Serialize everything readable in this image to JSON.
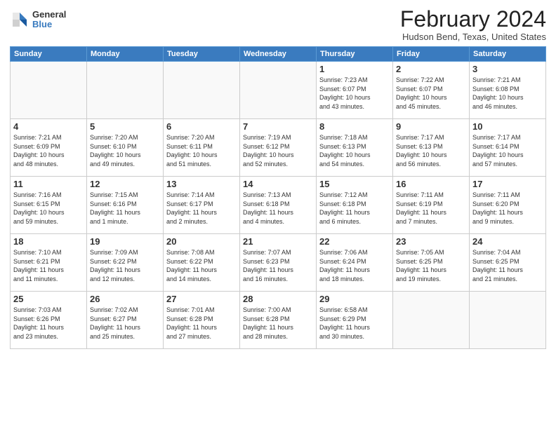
{
  "header": {
    "logo": {
      "general": "General",
      "blue": "Blue"
    },
    "title": "February 2024",
    "location": "Hudson Bend, Texas, United States"
  },
  "weekdays": [
    "Sunday",
    "Monday",
    "Tuesday",
    "Wednesday",
    "Thursday",
    "Friday",
    "Saturday"
  ],
  "weeks": [
    [
      {
        "day": "",
        "info": ""
      },
      {
        "day": "",
        "info": ""
      },
      {
        "day": "",
        "info": ""
      },
      {
        "day": "",
        "info": ""
      },
      {
        "day": "1",
        "info": "Sunrise: 7:23 AM\nSunset: 6:07 PM\nDaylight: 10 hours\nand 43 minutes."
      },
      {
        "day": "2",
        "info": "Sunrise: 7:22 AM\nSunset: 6:07 PM\nDaylight: 10 hours\nand 45 minutes."
      },
      {
        "day": "3",
        "info": "Sunrise: 7:21 AM\nSunset: 6:08 PM\nDaylight: 10 hours\nand 46 minutes."
      }
    ],
    [
      {
        "day": "4",
        "info": "Sunrise: 7:21 AM\nSunset: 6:09 PM\nDaylight: 10 hours\nand 48 minutes."
      },
      {
        "day": "5",
        "info": "Sunrise: 7:20 AM\nSunset: 6:10 PM\nDaylight: 10 hours\nand 49 minutes."
      },
      {
        "day": "6",
        "info": "Sunrise: 7:20 AM\nSunset: 6:11 PM\nDaylight: 10 hours\nand 51 minutes."
      },
      {
        "day": "7",
        "info": "Sunrise: 7:19 AM\nSunset: 6:12 PM\nDaylight: 10 hours\nand 52 minutes."
      },
      {
        "day": "8",
        "info": "Sunrise: 7:18 AM\nSunset: 6:13 PM\nDaylight: 10 hours\nand 54 minutes."
      },
      {
        "day": "9",
        "info": "Sunrise: 7:17 AM\nSunset: 6:13 PM\nDaylight: 10 hours\nand 56 minutes."
      },
      {
        "day": "10",
        "info": "Sunrise: 7:17 AM\nSunset: 6:14 PM\nDaylight: 10 hours\nand 57 minutes."
      }
    ],
    [
      {
        "day": "11",
        "info": "Sunrise: 7:16 AM\nSunset: 6:15 PM\nDaylight: 10 hours\nand 59 minutes."
      },
      {
        "day": "12",
        "info": "Sunrise: 7:15 AM\nSunset: 6:16 PM\nDaylight: 11 hours\nand 1 minute."
      },
      {
        "day": "13",
        "info": "Sunrise: 7:14 AM\nSunset: 6:17 PM\nDaylight: 11 hours\nand 2 minutes."
      },
      {
        "day": "14",
        "info": "Sunrise: 7:13 AM\nSunset: 6:18 PM\nDaylight: 11 hours\nand 4 minutes."
      },
      {
        "day": "15",
        "info": "Sunrise: 7:12 AM\nSunset: 6:18 PM\nDaylight: 11 hours\nand 6 minutes."
      },
      {
        "day": "16",
        "info": "Sunrise: 7:11 AM\nSunset: 6:19 PM\nDaylight: 11 hours\nand 7 minutes."
      },
      {
        "day": "17",
        "info": "Sunrise: 7:11 AM\nSunset: 6:20 PM\nDaylight: 11 hours\nand 9 minutes."
      }
    ],
    [
      {
        "day": "18",
        "info": "Sunrise: 7:10 AM\nSunset: 6:21 PM\nDaylight: 11 hours\nand 11 minutes."
      },
      {
        "day": "19",
        "info": "Sunrise: 7:09 AM\nSunset: 6:22 PM\nDaylight: 11 hours\nand 12 minutes."
      },
      {
        "day": "20",
        "info": "Sunrise: 7:08 AM\nSunset: 6:22 PM\nDaylight: 11 hours\nand 14 minutes."
      },
      {
        "day": "21",
        "info": "Sunrise: 7:07 AM\nSunset: 6:23 PM\nDaylight: 11 hours\nand 16 minutes."
      },
      {
        "day": "22",
        "info": "Sunrise: 7:06 AM\nSunset: 6:24 PM\nDaylight: 11 hours\nand 18 minutes."
      },
      {
        "day": "23",
        "info": "Sunrise: 7:05 AM\nSunset: 6:25 PM\nDaylight: 11 hours\nand 19 minutes."
      },
      {
        "day": "24",
        "info": "Sunrise: 7:04 AM\nSunset: 6:25 PM\nDaylight: 11 hours\nand 21 minutes."
      }
    ],
    [
      {
        "day": "25",
        "info": "Sunrise: 7:03 AM\nSunset: 6:26 PM\nDaylight: 11 hours\nand 23 minutes."
      },
      {
        "day": "26",
        "info": "Sunrise: 7:02 AM\nSunset: 6:27 PM\nDaylight: 11 hours\nand 25 minutes."
      },
      {
        "day": "27",
        "info": "Sunrise: 7:01 AM\nSunset: 6:28 PM\nDaylight: 11 hours\nand 27 minutes."
      },
      {
        "day": "28",
        "info": "Sunrise: 7:00 AM\nSunset: 6:28 PM\nDaylight: 11 hours\nand 28 minutes."
      },
      {
        "day": "29",
        "info": "Sunrise: 6:58 AM\nSunset: 6:29 PM\nDaylight: 11 hours\nand 30 minutes."
      },
      {
        "day": "",
        "info": ""
      },
      {
        "day": "",
        "info": ""
      }
    ]
  ]
}
